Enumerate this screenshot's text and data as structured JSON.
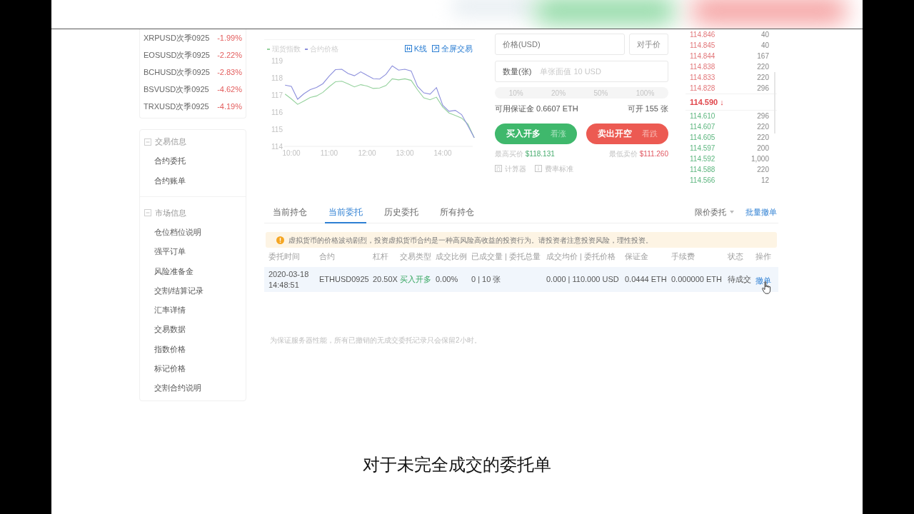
{
  "market_list": [
    {
      "name": "XRPUSD次季0925",
      "change": "-1.99%"
    },
    {
      "name": "EOSUSD次季0925",
      "change": "-2.22%"
    },
    {
      "name": "BCHUSD次季0925",
      "change": "-2.83%"
    },
    {
      "name": "BSVUSD次季0925",
      "change": "-4.62%"
    },
    {
      "name": "TRXUSD次季0925",
      "change": "-4.19%"
    }
  ],
  "sidebar_sections": [
    {
      "title": "交易信息",
      "expanded": true,
      "items": [
        "合约委托",
        "合约账单"
      ]
    },
    {
      "title": "市场信息",
      "expanded": true,
      "items": [
        "仓位档位说明",
        "强平订单",
        "风险准备金",
        "交割/结算记录",
        "汇率详情",
        "交易数据",
        "指数价格",
        "标记价格",
        "交割合约说明"
      ]
    }
  ],
  "chart": {
    "links": [
      {
        "kind": "kline",
        "label": "K线"
      },
      {
        "kind": "fullscreen",
        "label": "全屏交易"
      }
    ],
    "chart_data": {
      "type": "line",
      "categories": [
        null,
        "10:00",
        null,
        null,
        null,
        null,
        null,
        "11:00",
        null,
        null,
        null,
        null,
        null,
        "12:00",
        null,
        null,
        null,
        null,
        null,
        "13:00",
        null,
        null,
        null,
        null,
        null,
        "14:00",
        null,
        null,
        null,
        null,
        null
      ],
      "series": [
        {
          "name": "现货指数",
          "color": "#94d19c",
          "values": [
            117.05,
            116.77,
            116.45,
            116.65,
            116.86,
            116.94,
            117.15,
            117.48,
            117.77,
            117.8,
            117.64,
            117.47,
            117.6,
            117.52,
            117.38,
            117.41,
            117.55,
            117.94,
            117.88,
            117.94,
            117.85,
            117.3,
            116.83,
            116.72,
            116.87,
            116.3,
            115.95,
            115.8,
            115.65,
            115.3,
            114.5
          ]
        },
        {
          "name": "合约价格",
          "color": "#8c8fdc",
          "values": [
            117.57,
            117.5,
            116.75,
            117.07,
            117.31,
            117.44,
            117.66,
            118.1,
            118.48,
            118.5,
            118.25,
            118.12,
            118.35,
            118.14,
            117.95,
            117.93,
            118.2,
            118.7,
            118.45,
            118.5,
            118.4,
            117.5,
            117.12,
            117.05,
            117.43,
            116.4,
            116.05,
            116.1,
            115.85,
            115.2,
            114.5
          ]
        }
      ],
      "ylim": [
        114,
        119
      ],
      "yticks": [
        114,
        115,
        116,
        117,
        118,
        119
      ]
    }
  },
  "order_form": {
    "price_field": {
      "label": "价格(USD)"
    },
    "counterparty_button": "对手价",
    "quantity_field": {
      "label": "数量(张)",
      "placeholder": "单张面值 10 USD"
    },
    "percent_options": [
      {
        "label": "10%",
        "selected": false
      },
      {
        "label": "20%",
        "selected": false
      },
      {
        "label": "50%",
        "selected": false
      },
      {
        "label": "100%",
        "selected": false
      }
    ],
    "available_margin": "可用保证金 0.6607 ETH",
    "max_open": "可开 155 张",
    "actions": [
      {
        "kind": "buy",
        "label": "买入开多",
        "hint": "看涨"
      },
      {
        "kind": "sell",
        "label": "卖出开空",
        "hint": "看跌"
      }
    ],
    "best_prices": [
      {
        "kind": "buy",
        "label": "最高买价",
        "value": "$118.131"
      },
      {
        "kind": "sell",
        "label": "最低卖价",
        "value": "$111.260"
      }
    ],
    "tools": [
      {
        "kind": "calculator",
        "label": "计算器"
      },
      {
        "kind": "fees",
        "label": "费率标准"
      }
    ]
  },
  "order_book": {
    "asks": [
      {
        "price": "114.846",
        "amount": "40"
      },
      {
        "price": "114.845",
        "amount": "40"
      },
      {
        "price": "114.844",
        "amount": "167"
      },
      {
        "price": "114.838",
        "amount": "220"
      },
      {
        "price": "114.833",
        "amount": "220"
      },
      {
        "price": "114.828",
        "amount": "296"
      }
    ],
    "last_price": "114.590 ↓",
    "bids": [
      {
        "price": "114.610",
        "amount": "296"
      },
      {
        "price": "114.607",
        "amount": "220"
      },
      {
        "price": "114.605",
        "amount": "220"
      },
      {
        "price": "114.597",
        "amount": "200"
      },
      {
        "price": "114.592",
        "amount": "1,000"
      },
      {
        "price": "114.588",
        "amount": "220"
      },
      {
        "price": "114.566",
        "amount": "12"
      }
    ]
  },
  "orders": {
    "tabs": [
      {
        "label": "当前持仓",
        "selected": false
      },
      {
        "label": "当前委托",
        "selected": true
      },
      {
        "label": "历史委托",
        "selected": false
      },
      {
        "label": "所有持仓",
        "selected": false
      }
    ],
    "order_type": "限价委托",
    "batch_cancel": "批量撤单",
    "warning": "虚拟货币的价格波动剧烈，投资虚拟货币合约是一种高风险高收益的投资行为。请投资者注意投资风险，理性投资。",
    "table": {
      "columns": [
        "委托时间",
        "合约",
        "杠杆",
        "交易类型",
        "成交比例",
        "已成交量 | 委托总量",
        "成交均价 | 委托价格",
        "保证金",
        "手续费",
        "状态",
        "操作"
      ],
      "rows": [
        {
          "highlighted": true,
          "cells": [
            {
              "kind": "text",
              "text": "2020-03-18 14:48:51"
            },
            {
              "kind": "text",
              "text": "ETHUSD0925"
            },
            {
              "kind": "text",
              "text": "20.50X"
            },
            {
              "kind": "buy",
              "text": "买入开多"
            },
            {
              "kind": "text",
              "text": "0.00%"
            },
            {
              "kind": "text",
              "text": "0 | 10 张"
            },
            {
              "kind": "text",
              "text": "0.000 | 110.000 USD"
            },
            {
              "kind": "text",
              "text": "0.0444 ETH"
            },
            {
              "kind": "text",
              "text": "0.000000 ETH"
            },
            {
              "kind": "text",
              "text": "待成交"
            },
            {
              "kind": "action",
              "text": "撤单"
            }
          ]
        }
      ]
    },
    "footer_note": "为保证服务器性能，所有已撤销的无成交委托记录只会保留2小时。"
  },
  "subtitle": "对于未完全成交的委托单"
}
